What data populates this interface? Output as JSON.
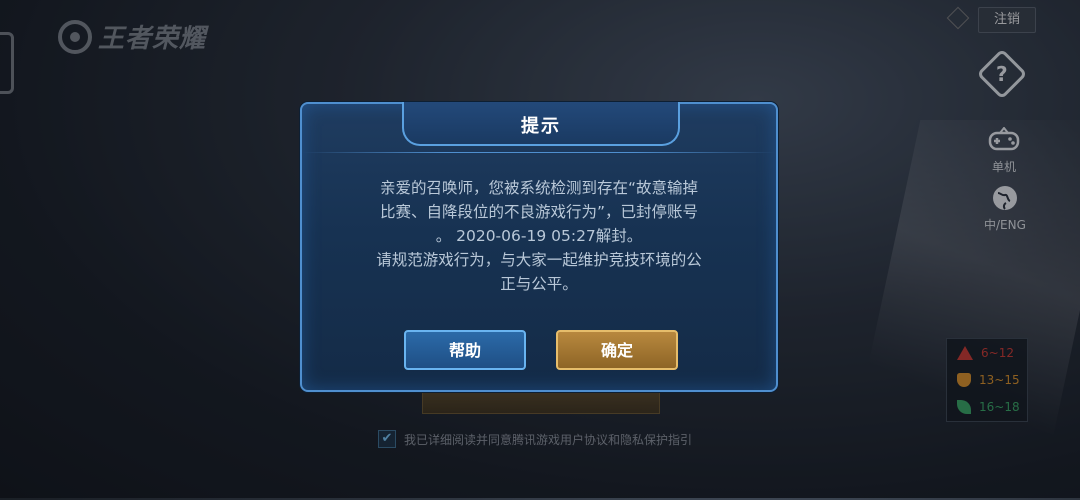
{
  "game": {
    "logo_text": "王者荣耀"
  },
  "topbar": {
    "logout_label": "注销"
  },
  "side_menu": [
    {
      "icon": "help-icon",
      "label": ""
    },
    {
      "icon": "gamepad-icon",
      "label": "单机"
    },
    {
      "icon": "globe-icon",
      "label": "中/ENG"
    }
  ],
  "age_rating": [
    {
      "icon": "warning-icon",
      "label": "6~12",
      "color": "#c83a32"
    },
    {
      "icon": "shield-icon",
      "label": "13~15",
      "color": "#d8902a"
    },
    {
      "icon": "leaf-icon",
      "label": "16~18",
      "color": "#3aa463"
    }
  ],
  "agreement": {
    "text": "我已详细阅读并同意腾讯游戏用户协议和隐私保护指引"
  },
  "dialog": {
    "title": "提示",
    "message_line1": "亲爱的召唤师，您被系统检测到存在“故意输掉",
    "message_line2": "比赛、自降段位的不良游戏行为”，已封停账号",
    "message_line3": "。 2020-06-19 05:27解封。",
    "message_line4": "请规范游戏行为，与大家一起维护竞技环境的公",
    "message_line5": "正与公平。",
    "help_button": "帮助",
    "ok_button": "确定"
  }
}
